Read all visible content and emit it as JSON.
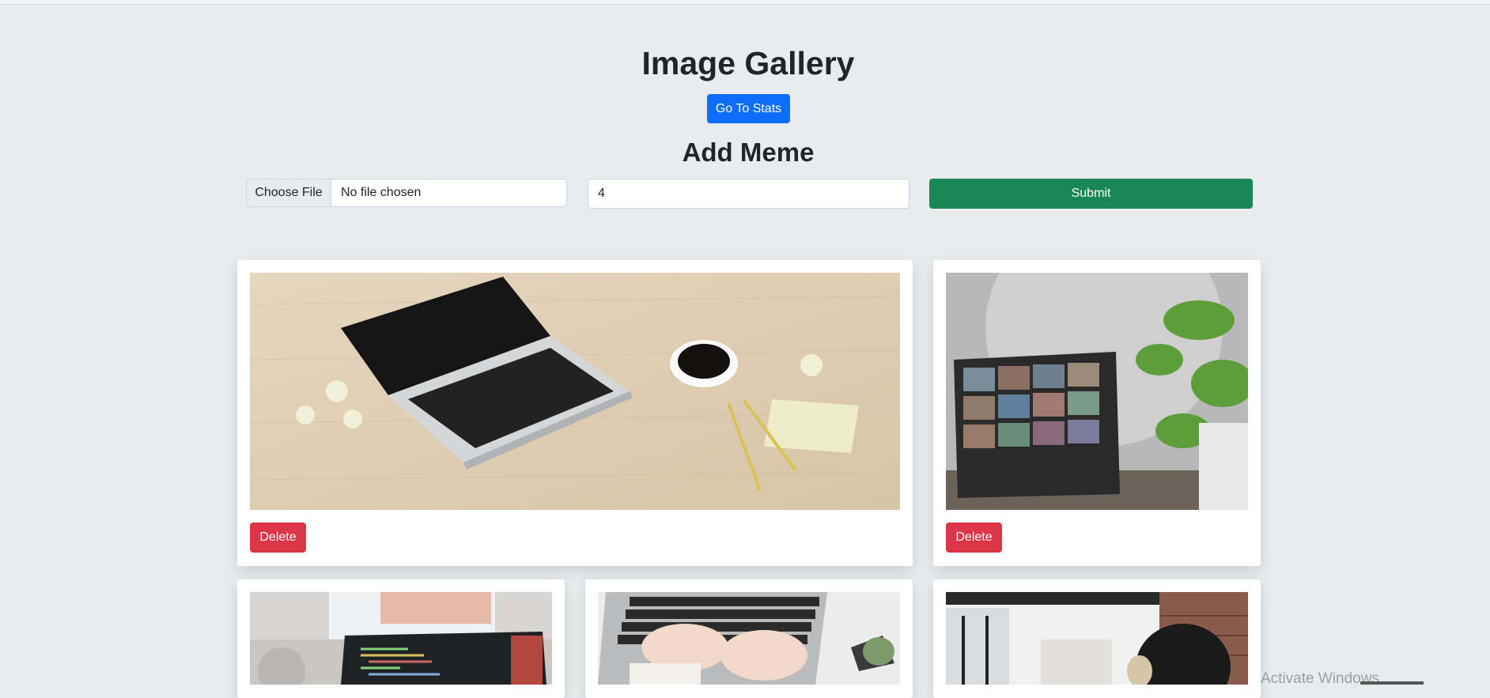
{
  "header": {
    "title": "Image Gallery",
    "stats_button": "Go To Stats",
    "form_title": "Add Meme"
  },
  "form": {
    "file_button": "Choose File",
    "file_status": "No file chosen",
    "number_value": "4",
    "submit_label": "Submit"
  },
  "gallery": {
    "delete_label": "Delete",
    "items": [
      {
        "subject": "laptop on wooden desk with coffee and notes"
      },
      {
        "subject": "laptop video call with plant"
      },
      {
        "subject": "laptop with code by window"
      },
      {
        "subject": "hands typing on laptop keyboard"
      },
      {
        "subject": "person with headphones in office"
      }
    ]
  },
  "os_overlay": {
    "watermark": "Activate Windows"
  }
}
